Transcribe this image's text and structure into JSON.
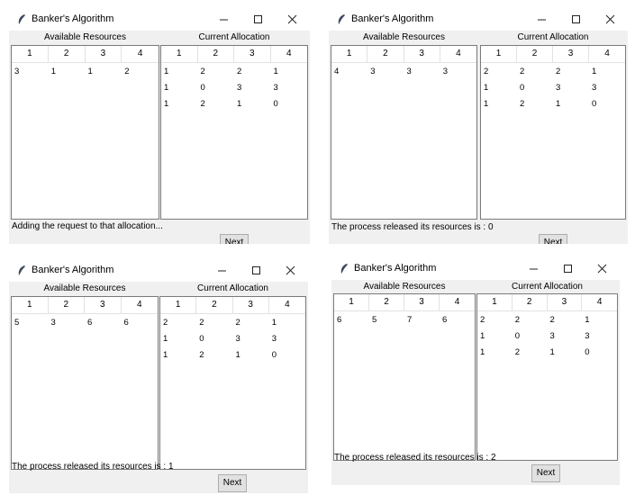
{
  "app_title": "Banker's Algorithm",
  "available_header": "Available Resources",
  "allocation_header": "Current Allocation",
  "columns": [
    "1",
    "2",
    "3",
    "4"
  ],
  "next_label": "Next",
  "screens": [
    {
      "available": [
        [
          "3",
          "1",
          "1",
          "2"
        ]
      ],
      "allocation": [
        [
          "1",
          "2",
          "2",
          "1"
        ],
        [
          "1",
          "0",
          "3",
          "3"
        ],
        [
          "1",
          "2",
          "1",
          "0"
        ]
      ],
      "status": "Adding the request to that allocation..."
    },
    {
      "available": [
        [
          "4",
          "3",
          "3",
          "3"
        ]
      ],
      "allocation": [
        [
          "2",
          "2",
          "2",
          "1"
        ],
        [
          "1",
          "0",
          "3",
          "3"
        ],
        [
          "1",
          "2",
          "1",
          "0"
        ]
      ],
      "status": "The process released its resources is : 0"
    },
    {
      "available": [
        [
          "5",
          "3",
          "6",
          "6"
        ]
      ],
      "allocation": [
        [
          "2",
          "2",
          "2",
          "1"
        ],
        [
          "1",
          "0",
          "3",
          "3"
        ],
        [
          "1",
          "2",
          "1",
          "0"
        ]
      ],
      "status": "The process released its resources is : 1"
    },
    {
      "available": [
        [
          "6",
          "5",
          "7",
          "6"
        ]
      ],
      "allocation": [
        [
          "2",
          "2",
          "2",
          "1"
        ],
        [
          "1",
          "0",
          "3",
          "3"
        ],
        [
          "1",
          "2",
          "1",
          "0"
        ]
      ],
      "status": "The process released its resources is : 2"
    }
  ]
}
